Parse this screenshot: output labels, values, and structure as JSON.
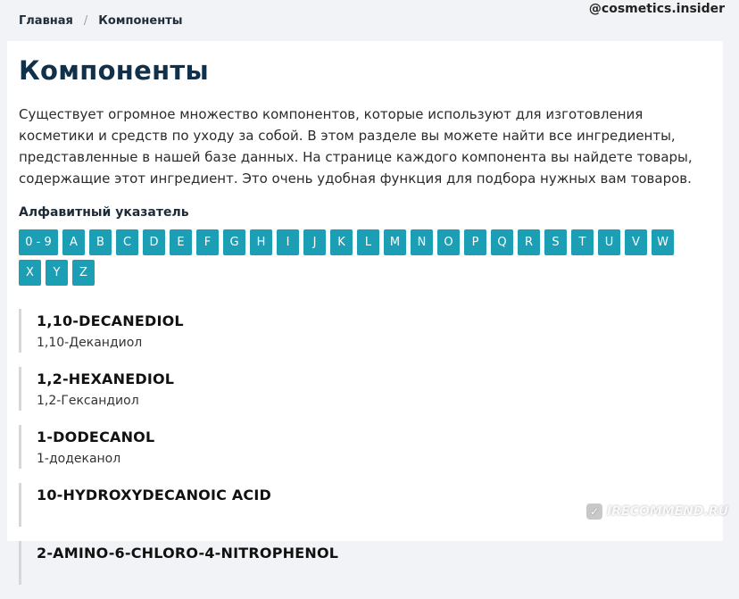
{
  "breadcrumb": {
    "home": "Главная",
    "separator": "/",
    "current": "Компоненты"
  },
  "watermark": {
    "top": "@cosmetics.insider",
    "bottom": "IRECOMMEND.RU"
  },
  "page": {
    "title": "Компоненты",
    "intro": "Существует огромное множество компонентов, которые используют для изготовления косметики и средств по уходу за собой. В этом разделе вы можете найти все ингредиенты, представленные в нашей базе данных. На странице каждого компонента вы найдете товары, содержащие этот ингредиент. Это очень удобная функция для подбора нужных вам товаров."
  },
  "alphabet": {
    "title": "Алфавитный указатель",
    "letters": [
      "0 - 9",
      "A",
      "B",
      "C",
      "D",
      "E",
      "F",
      "G",
      "H",
      "I",
      "J",
      "K",
      "L",
      "M",
      "N",
      "O",
      "P",
      "Q",
      "R",
      "S",
      "T",
      "U",
      "V",
      "W",
      "X",
      "Y",
      "Z"
    ]
  },
  "components": [
    {
      "name": "1,10-DECANEDIOL",
      "ru": "1,10-Декандиол"
    },
    {
      "name": "1,2-HEXANEDIOL",
      "ru": "1,2-Гександиол"
    },
    {
      "name": "1-DODECANOL",
      "ru": "1-додеканол"
    },
    {
      "name": "10-HYDROXYDECANOIC ACID",
      "ru": ""
    },
    {
      "name": "2-AMINO-6-CHLORO-4-NITROPHENOL",
      "ru": ""
    }
  ],
  "colors": {
    "accent": "#1c9eb4",
    "title": "#11304a",
    "background": "#f2f3f6"
  }
}
